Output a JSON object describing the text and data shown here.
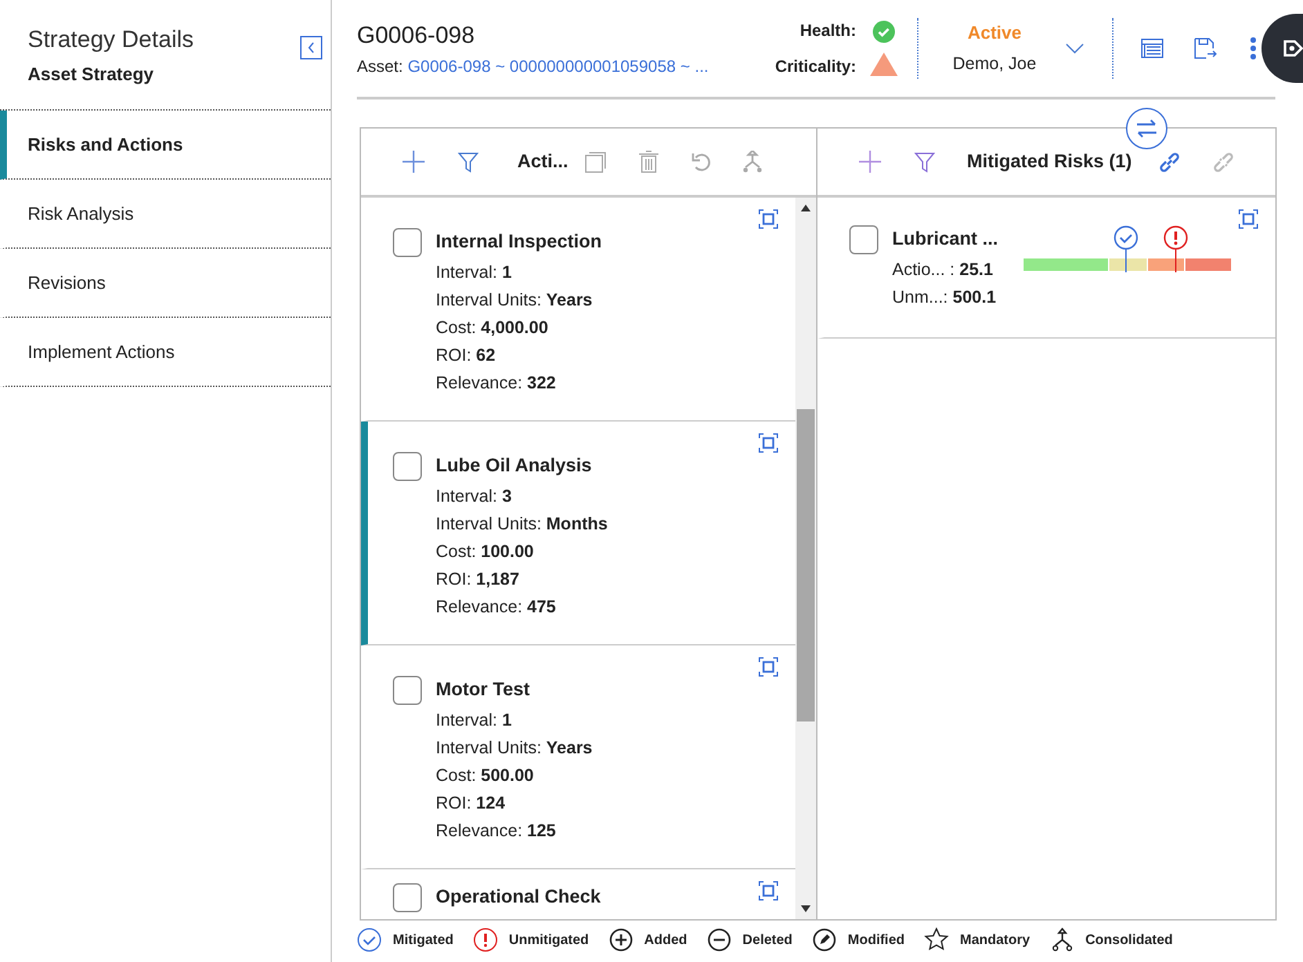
{
  "sidebar": {
    "title": "Strategy Details",
    "subtitle": "Asset Strategy",
    "items": [
      {
        "label": "Risks and Actions",
        "selected": true
      },
      {
        "label": "Risk Analysis",
        "selected": false
      },
      {
        "label": "Revisions",
        "selected": false
      },
      {
        "label": "Implement Actions",
        "selected": false
      }
    ]
  },
  "header": {
    "title": "G0006-098",
    "asset_label": "Asset:",
    "asset_link": "G0006-098 ~ 000000000001059058 ~ ...",
    "health_label": "Health:",
    "criticality_label": "Criticality:",
    "status": "Active",
    "user": "Demo, Joe"
  },
  "actions_panel": {
    "title": "Acti...",
    "cards": [
      {
        "title": "Internal Inspection",
        "selected": false,
        "checked": false,
        "fields": [
          {
            "label": "Interval:",
            "value": "1"
          },
          {
            "label": "Interval Units:",
            "value": "Years"
          },
          {
            "label": "Cost:",
            "value": "4,000.00"
          },
          {
            "label": "ROI:",
            "value": "62"
          },
          {
            "label": "Relevance:",
            "value": "322"
          }
        ]
      },
      {
        "title": "Lube Oil Analysis",
        "selected": true,
        "checked": false,
        "fields": [
          {
            "label": "Interval:",
            "value": "3"
          },
          {
            "label": "Interval Units:",
            "value": "Months"
          },
          {
            "label": "Cost:",
            "value": "100.00"
          },
          {
            "label": "ROI:",
            "value": "1,187"
          },
          {
            "label": "Relevance:",
            "value": "475"
          }
        ]
      },
      {
        "title": "Motor Test",
        "selected": false,
        "checked": false,
        "fields": [
          {
            "label": "Interval:",
            "value": "1"
          },
          {
            "label": "Interval Units:",
            "value": "Years"
          },
          {
            "label": "Cost:",
            "value": "500.00"
          },
          {
            "label": "ROI:",
            "value": "124"
          },
          {
            "label": "Relevance:",
            "value": "125"
          }
        ]
      },
      {
        "title": "Operational Check",
        "selected": false,
        "checked": false
      }
    ]
  },
  "risks_panel": {
    "title": "Mitigated Risks (1)",
    "cards": [
      {
        "title": "Lubricant ...",
        "checked": false,
        "fields": [
          {
            "label": "Actio... :",
            "value": "25.1"
          },
          {
            "label": "Unm...:",
            "value": "500.1"
          }
        ],
        "markers": [
          {
            "kind": "mitigated",
            "level": 0.49
          },
          {
            "kind": "unmitigated",
            "level": 0.73
          }
        ]
      }
    ]
  },
  "legend": [
    {
      "kind": "mitigated",
      "label": "Mitigated"
    },
    {
      "kind": "unmitigated",
      "label": "Unmitigated"
    },
    {
      "kind": "added",
      "label": "Added"
    },
    {
      "kind": "deleted",
      "label": "Deleted"
    },
    {
      "kind": "modified",
      "label": "Modified"
    },
    {
      "kind": "mandatory",
      "label": "Mandatory"
    },
    {
      "kind": "consolidated",
      "label": "Consolidated"
    }
  ]
}
